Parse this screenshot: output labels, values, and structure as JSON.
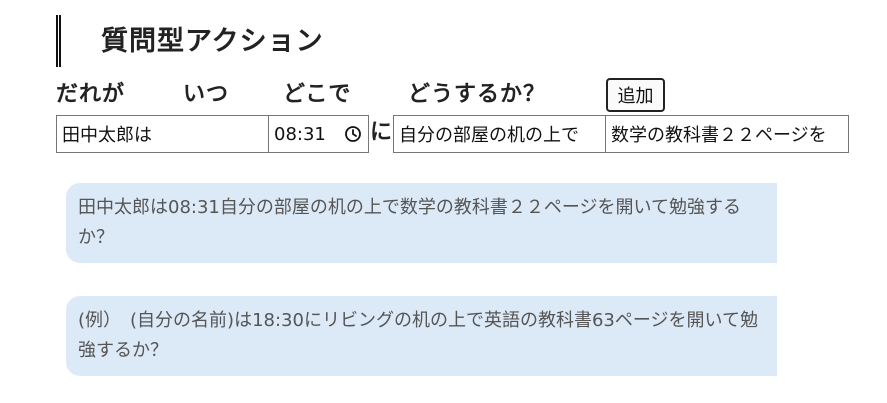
{
  "title": "質問型アクション",
  "labels": {
    "who": "だれが",
    "when": "いつ",
    "where": "どこで",
    "what": "どうするか？",
    "ni": "に"
  },
  "add_button_label": "追加",
  "inputs": {
    "who": "田中太郎は",
    "time": "08:31",
    "where": "自分の部屋の机の上で",
    "what": "数学の教科書２２ページを"
  },
  "sentences": [
    "田中太郎は08:31自分の部屋の机の上で数学の教科書２２ページを開いて勉強するか？",
    "(例）　(自分の名前)は18:30にリビングの机の上で英語の教科書63ページを開いて勉強するか？"
  ],
  "colors": {
    "bubble_bg": "#dce9f7",
    "text": "#222222"
  },
  "icons": {
    "time_picker": "clock-icon"
  }
}
